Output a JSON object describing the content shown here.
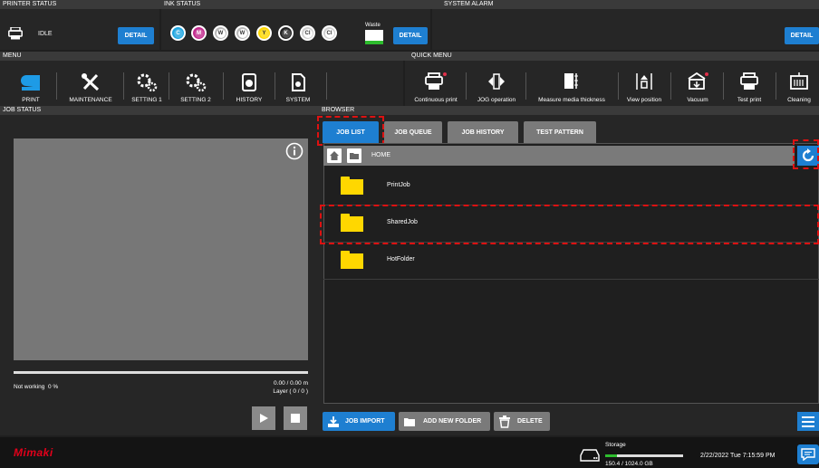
{
  "status_bar": {
    "printer_status_label": "PRINTER STATUS",
    "printer_state": "IDLE",
    "printer_detail": "DETAIL",
    "ink_status_label": "INK STATUS",
    "ink_detail": "DETAIL",
    "waste_label": "Waste",
    "system_alarm_label": "SYSTEM ALARM",
    "alarm_detail": "DETAIL",
    "inks": [
      {
        "letter": "C",
        "color": "#1ea5e0"
      },
      {
        "letter": "M",
        "color": "#c12a8c"
      },
      {
        "letter": "W",
        "color": "#b9b9b9"
      },
      {
        "letter": "W",
        "color": "#b9b9b9"
      },
      {
        "letter": "Y",
        "color": "#ffd800"
      },
      {
        "letter": "K",
        "color": "#222222"
      },
      {
        "letter": "Cl",
        "color": "#cfcfcf"
      },
      {
        "letter": "Cl",
        "color": "#cfcfcf"
      }
    ]
  },
  "menu": {
    "label": "MENU",
    "items": [
      "PRINT",
      "MAINTENANCE",
      "SETTING 1",
      "SETTING 2",
      "HISTORY",
      "SYSTEM"
    ]
  },
  "quick_menu": {
    "label": "QUICK MENU",
    "items": [
      "Continuous print",
      "JOG operation",
      "Measure media thickness",
      "View position",
      "Vacuum",
      "Test print",
      "Cleaning"
    ]
  },
  "job_status": {
    "label": "JOB STATUS",
    "state": "Not working",
    "progress_text": "0 %",
    "progress_fraction": 0,
    "length_text": "0.00 / 0.00 m",
    "layer_text": "Layer ( 0 / 0 )"
  },
  "browser": {
    "label": "BROWSER",
    "tabs": [
      "JOB LIST",
      "JOB QUEUE",
      "JOB HISTORY",
      "TEST PATTERN"
    ],
    "path": "HOME",
    "rows": [
      "PrintJob",
      "SharedJob",
      "HotFolder"
    ],
    "actions": {
      "import": "JOB IMPORT",
      "new_folder": "ADD NEW FOLDER",
      "delete": "DELETE"
    }
  },
  "footer": {
    "logo": "Mimaki",
    "storage_label": "Storage",
    "storage_text": "150.4 / 1024.0 GB",
    "storage_fraction": 0.147,
    "datetime": "2/22/2022 Tue 7:15:59 PM"
  },
  "colors": {
    "accent": "#1e7fd1",
    "highlight": "#dd1111",
    "folder": "#ffd700"
  }
}
